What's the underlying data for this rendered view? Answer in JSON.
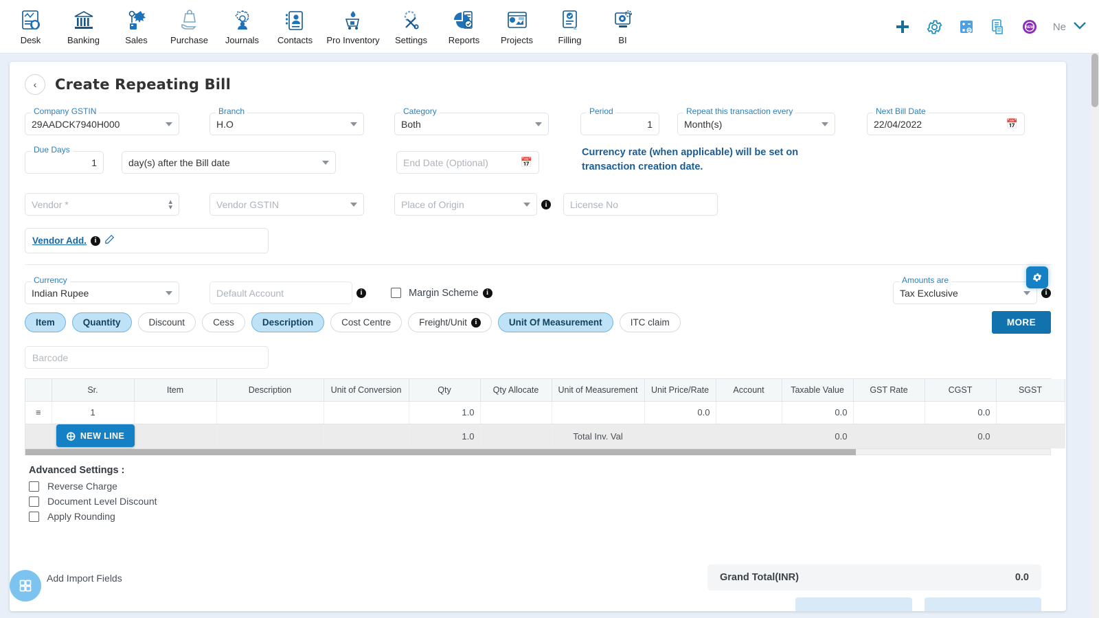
{
  "topnav": {
    "items": [
      {
        "label": "Desk",
        "icon": "desk-dashboard-icon"
      },
      {
        "label": "Banking",
        "icon": "bank-building-icon"
      },
      {
        "label": "Sales",
        "icon": "sales-megaphone-icon"
      },
      {
        "label": "Purchase",
        "icon": "purchase-bag-icon"
      },
      {
        "label": "Journals",
        "icon": "journals-gear-people-icon"
      },
      {
        "label": "Contacts",
        "icon": "contacts-card-icon"
      },
      {
        "label": "Pro Inventory",
        "icon": "inventory-cart-icon"
      },
      {
        "label": "Settings",
        "icon": "settings-tools-icon"
      },
      {
        "label": "Reports",
        "icon": "reports-piechart-icon"
      },
      {
        "label": "Projects",
        "icon": "projects-board-icon"
      },
      {
        "label": "Filling",
        "icon": "filling-document-check-icon"
      },
      {
        "label": "BI",
        "icon": "bi-monitor-icon"
      }
    ],
    "actions": [
      {
        "name": "add-icon",
        "glyph": "+"
      },
      {
        "name": "gear-icon",
        "glyph": "⚙"
      },
      {
        "name": "calculator-icon",
        "glyph": "calc"
      },
      {
        "name": "document-icon",
        "glyph": "doc"
      },
      {
        "name": "new-badge-icon",
        "glyph": "NEW"
      }
    ],
    "user_label": "Ne"
  },
  "page": {
    "title": "Create Repeating Bill",
    "back_icon": "chevron-left-icon"
  },
  "form": {
    "company_gstin": {
      "label": "Company GSTIN",
      "value": "29AADCK7940H000"
    },
    "branch": {
      "label": "Branch",
      "value": "H.O"
    },
    "category": {
      "label": "Category",
      "value": "Both"
    },
    "period": {
      "label": "Period",
      "value": "1"
    },
    "repeat_every": {
      "label": "Repeat this transaction every",
      "value": "Month(s)"
    },
    "next_bill_date": {
      "label": "Next Bill Date",
      "value": "22/04/2022"
    },
    "due_days": {
      "label": "Due Days",
      "value": "1"
    },
    "due_days_mode": {
      "value": "day(s) after the Bill date"
    },
    "end_date": {
      "placeholder": "End Date (Optional)",
      "value": ""
    },
    "currency_note": "Currency rate (when applicable) will be set on transaction creation date.",
    "vendor": {
      "placeholder": "Vendor *",
      "value": ""
    },
    "vendor_gstin": {
      "placeholder": "Vendor GSTIN",
      "value": ""
    },
    "place_of_origin": {
      "placeholder": "Place of Origin",
      "value": ""
    },
    "license_no": {
      "placeholder": "License No",
      "value": ""
    },
    "vendor_address_link": "Vendor Add.",
    "currency": {
      "label": "Currency",
      "value": "Indian Rupee"
    },
    "default_account": {
      "placeholder": "Default Account",
      "value": ""
    },
    "margin_scheme": {
      "label": "Margin Scheme",
      "checked": false
    },
    "amounts_are": {
      "label": "Amounts are",
      "value": "Tax Exclusive"
    }
  },
  "chips": [
    {
      "label": "Item",
      "selected": true
    },
    {
      "label": "Quantity",
      "selected": true
    },
    {
      "label": "Discount",
      "selected": false
    },
    {
      "label": "Cess",
      "selected": false
    },
    {
      "label": "Description",
      "selected": true
    },
    {
      "label": "Cost Centre",
      "selected": false
    },
    {
      "label": "Freight/Unit",
      "selected": false,
      "info": true
    },
    {
      "label": "Unit Of Measurement",
      "selected": true
    },
    {
      "label": "ITC claim",
      "selected": false
    }
  ],
  "more_button": "MORE",
  "barcode": {
    "placeholder": "Barcode",
    "value": ""
  },
  "table": {
    "columns": [
      "",
      "Sr.",
      "Item",
      "Description",
      "Unit of Conversion",
      "Qty",
      "Qty Allocate",
      "Unit of Measurement",
      "Unit Price/Rate",
      "Account",
      "Taxable Value",
      "GST Rate",
      "CGST",
      "SGST"
    ],
    "rows": [
      {
        "handle": "≡",
        "sr": "1",
        "item": "",
        "description": "",
        "unit_of_conversion": "",
        "qty": "1.0",
        "qty_allocate": "",
        "unit_of_measurement": "",
        "unit_price_rate": "0.0",
        "account": "",
        "taxable_value": "0.0",
        "gst_rate": "",
        "cgst": "0.0",
        "sgst": ""
      }
    ],
    "total_row": {
      "qty": "1.0",
      "label": "Total Inv. Val",
      "taxable_value": "0.0",
      "cgst": "0.0"
    },
    "new_line_button": "NEW LINE"
  },
  "advanced": {
    "title": "Advanced Settings :",
    "options": [
      {
        "label": "Reverse Charge",
        "checked": false
      },
      {
        "label": "Document Level Discount",
        "checked": false
      },
      {
        "label": "Apply Rounding",
        "checked": false
      }
    ]
  },
  "import_fields_label": "Add Import Fields",
  "grand_total": {
    "label": "Grand Total(INR)",
    "value": "0.0"
  },
  "colors": {
    "accent_blue": "#1581c4",
    "chip_selected": "#bfe2f7",
    "label_blue": "#2d7fb8",
    "note_blue": "#1a5c94",
    "page_bg": "#e8eff8"
  }
}
